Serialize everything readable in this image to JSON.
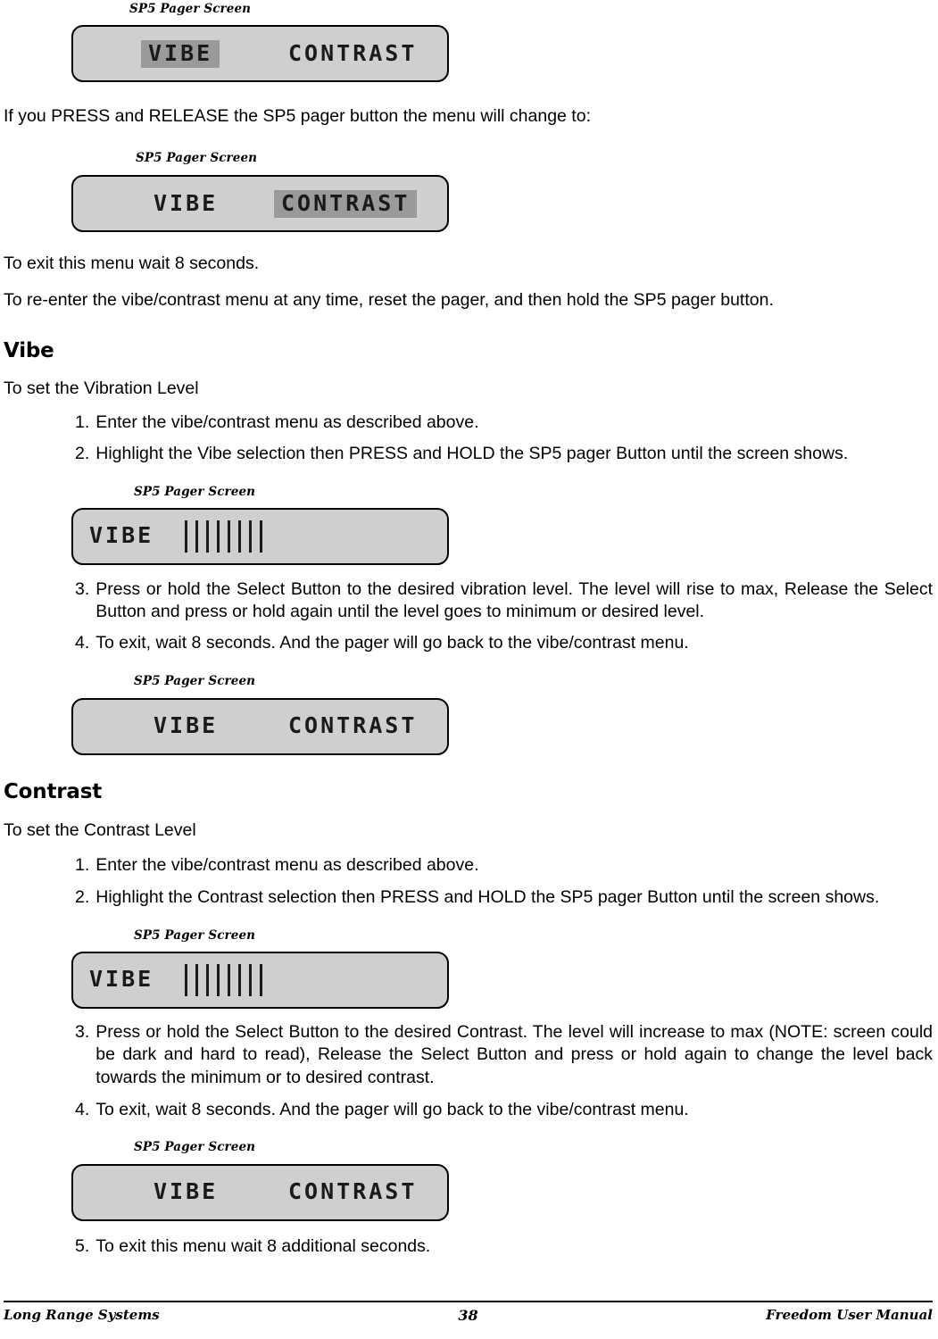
{
  "document": {
    "footer": {
      "left": "Long Range Systems",
      "page": "38",
      "right": "Freedom User Manual"
    }
  },
  "captions": {
    "pager_screen": "SP5 Pager Screen"
  },
  "screens": {
    "vibe_highlighted": {
      "left": "VIBE",
      "right": "CONTRAST",
      "highlight": "left"
    },
    "contrast_highlighted": {
      "left": "VIBE",
      "right": "CONTRAST",
      "highlight": "right"
    },
    "vibe_bars": {
      "left": "VIBE",
      "bars": 8
    },
    "menu_plain": {
      "left": "VIBE",
      "right": "CONTRAST",
      "highlight": "none"
    }
  },
  "text": {
    "press_release": "If you PRESS and RELEASE the SP5 pager button the menu will change to:",
    "exit_wait": "To exit this menu wait 8 seconds.",
    "reenter": "To re-enter the vibe/contrast menu at any time, reset the pager, and then hold the SP5 pager button."
  },
  "vibe_section": {
    "heading": "Vibe",
    "intro": "To set the Vibration Level",
    "step1_num": "1.",
    "step1": "Enter the vibe/contrast menu as described above.",
    "step2_num": "2.",
    "step2": "Highlight the Vibe selection then PRESS and HOLD the SP5 pager Button until the screen shows.",
    "step3_num": "3.",
    "step3": " Press or hold the Select Button to the desired vibration level.  The level will rise to max, Release the Select Button and press or hold again until the level goes to minimum or desired level.",
    "step4_num": "4.",
    "step4": "To exit, wait 8 seconds. And the pager will go back to the vibe/contrast menu."
  },
  "contrast_section": {
    "heading": "Contrast",
    "intro": "To set the Contrast Level",
    "step1_num": "1.",
    "step1": "Enter the vibe/contrast menu as described above.",
    "step2_num": "2.",
    "step2": "Highlight the Contrast selection then PRESS and HOLD the SP5 pager Button until the screen shows.",
    "step3_num": "3.",
    "step3": "Press or hold the Select Button to the desired Contrast.  The level will increase to max (NOTE: screen could be dark and hard to read), Release the Select Button and press or hold again to change the level back towards the minimum or to desired contrast.",
    "step4_num": "4.",
    "step4": "To exit, wait 8 seconds. And the pager will go back to the vibe/contrast menu.",
    "step5_num": "5.",
    "step5": "To exit this menu wait 8 additional seconds."
  }
}
